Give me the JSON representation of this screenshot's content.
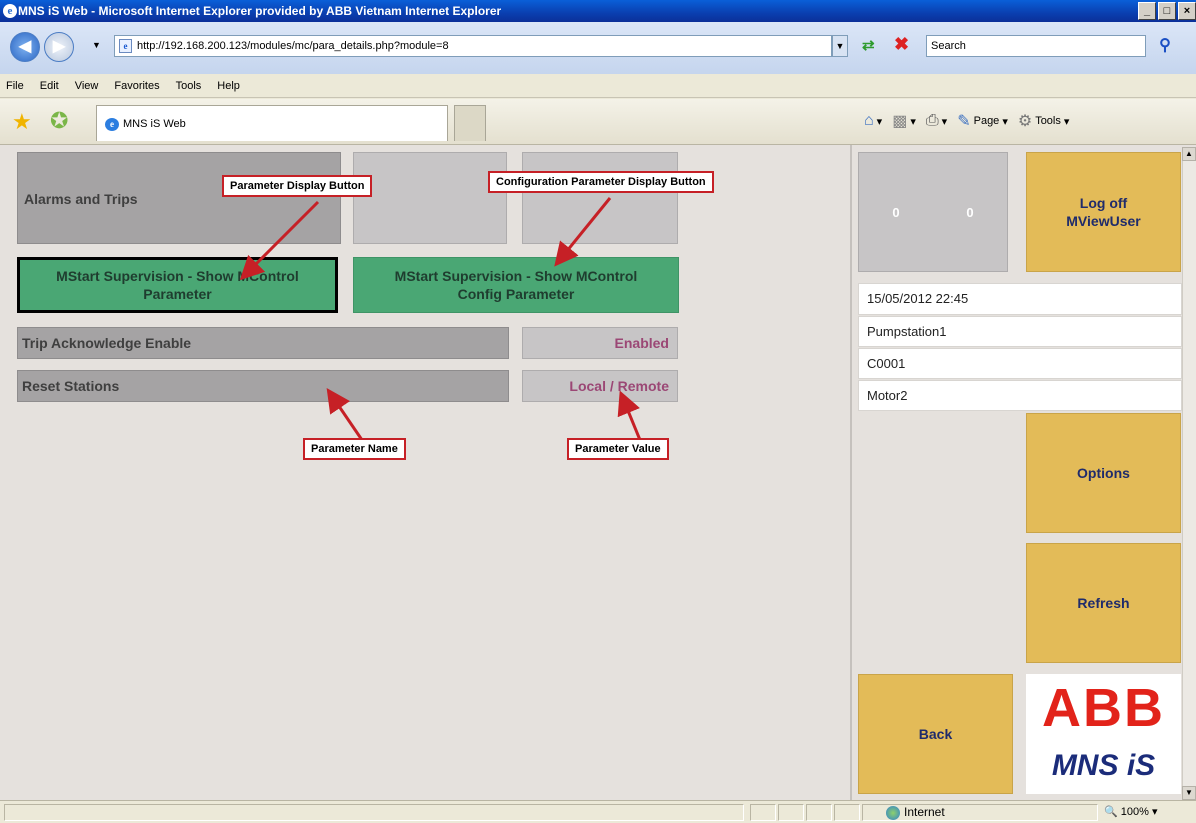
{
  "window": {
    "title": "MNS iS Web - Microsoft Internet Explorer provided by ABB Vietnam Internet Explorer",
    "controls": [
      "_",
      "□",
      "×"
    ]
  },
  "address_bar": {
    "url": "http://192.168.200.123/modules/mc/para_details.php?module=8",
    "search_placeholder": "Search"
  },
  "menu": [
    "File",
    "Edit",
    "View",
    "Favorites",
    "Tools",
    "Help"
  ],
  "tab": {
    "title": "MNS iS Web"
  },
  "command_bar": {
    "page_label": "Page",
    "tools_label": "Tools"
  },
  "main": {
    "header_title": "Alarms and Trips",
    "buttons": {
      "show_parameter": "MStart Supervision - Show MControl Parameter",
      "show_config_parameter": "MStart Supervision - Show MControl Config Parameter"
    },
    "parameters": [
      {
        "name": "Trip Acknowledge Enable",
        "value": "Enabled"
      },
      {
        "name": "Reset Stations",
        "value": "Local / Remote"
      }
    ]
  },
  "callouts": {
    "parameter_display_button": "Parameter Display Button",
    "config_parameter_display_button": "Configuration Parameter Display Button",
    "parameter_name": "Parameter Name",
    "parameter_value": "Parameter Value"
  },
  "sidebar": {
    "counter_left": "0",
    "counter_right": "0",
    "logoff_label": "Log off MViewUser",
    "datetime": "15/05/2012 22:45",
    "station": "Pumpstation1",
    "code": "C0001",
    "motor": "Motor2",
    "options_label": "Options",
    "refresh_label": "Refresh",
    "back_label": "Back",
    "logo_brand": "ABB",
    "logo_product": "MNS iS"
  },
  "status_bar": {
    "zone": "Internet",
    "zoom": "100%"
  },
  "colors": {
    "green_button": "#4aa774",
    "yellow_button": "#e3bb58",
    "gray_row": "#a5a3a4",
    "value_text": "#9b4775",
    "abb_red": "#e2231a",
    "mns_blue": "#1b2c7a",
    "callout_border": "#c62026"
  }
}
